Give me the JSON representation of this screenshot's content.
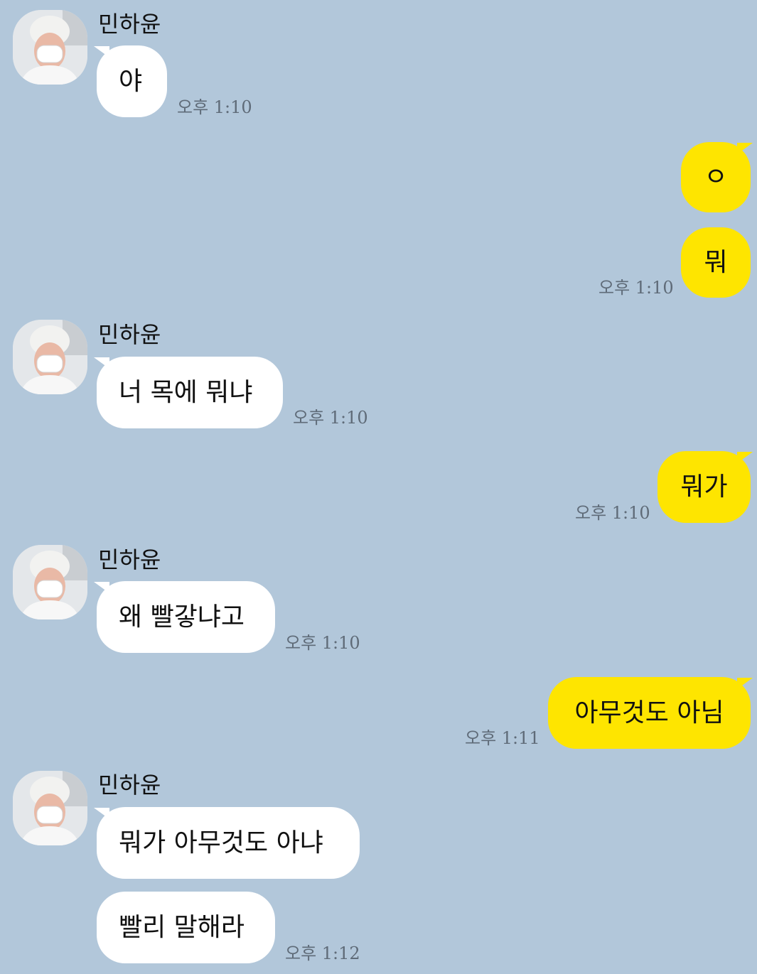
{
  "chat": {
    "contact_name": "민하윤",
    "colors": {
      "background": "#b2c7da",
      "incoming_bubble": "#ffffff",
      "outgoing_bubble": "#fee500"
    },
    "messages": [
      {
        "from": "contact",
        "text": "야",
        "time": "오후 1:10"
      },
      {
        "from": "me",
        "text": "ㅇ",
        "time": ""
      },
      {
        "from": "me",
        "text": "뭐",
        "time": "오후 1:10"
      },
      {
        "from": "contact",
        "text": "너 목에 뭐냐",
        "time": "오후 1:10"
      },
      {
        "from": "me",
        "text": "뭐가",
        "time": "오후 1:10"
      },
      {
        "from": "contact",
        "text": "왜 빨갛냐고",
        "time": "오후 1:10"
      },
      {
        "from": "me",
        "text": "아무것도 아님",
        "time": "오후 1:11"
      },
      {
        "from": "contact",
        "text": "뭐가 아무것도 아냐",
        "time": ""
      },
      {
        "from": "contact",
        "text": "빨리 말해라",
        "time": "오후 1:12"
      }
    ]
  }
}
